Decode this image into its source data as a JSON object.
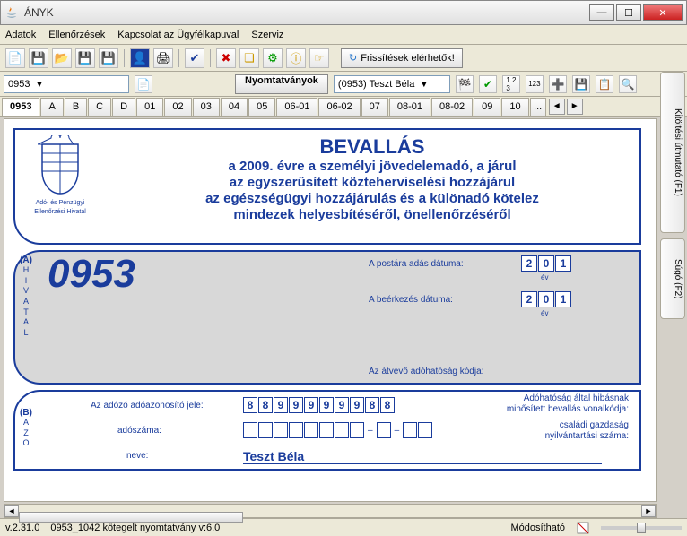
{
  "window": {
    "title": "ÁNYK"
  },
  "menu": {
    "items": [
      "Adatok",
      "Ellenőrzések",
      "Kapcsolat az Ügyfélkapuval",
      "Szerviz"
    ]
  },
  "toolbar": {
    "update_label": "Frissítések elérhetők!"
  },
  "selector": {
    "form_code": "0953",
    "nyom_label": "Nyomtatványok",
    "person": "(0953) Teszt Béla"
  },
  "tabs": [
    "0953",
    "A",
    "B",
    "C",
    "D",
    "01",
    "02",
    "03",
    "04",
    "05",
    "06-01",
    "06-02",
    "07",
    "08-01",
    "08-02",
    "09",
    "10"
  ],
  "form": {
    "apeh_line1": "Adó- és Pénzügyi",
    "apeh_line2": "Ellenőrzési Hivatal",
    "title": "BEVALLÁS",
    "sub1": "a 2009. évre a személyi jövedelemadó, a járul",
    "sub2": "az egyszerűsített közteherviselési hozzájárul",
    "sub3": "az egészségügyi hozzájárulás és a különadó kötelez",
    "sub4": "mindezek helyesbítéséről, önellenőrzéséről",
    "side_a": "(A)",
    "side_a_letters": [
      "H",
      "I",
      "V",
      "A",
      "T",
      "A",
      "L"
    ],
    "form_number": "0953",
    "post_date_label": "A postára adás dátuma:",
    "recv_date_label": "A beérkezés dátuma:",
    "ev": "év",
    "date1": [
      "2",
      "0",
      "1"
    ],
    "date2": [
      "2",
      "0",
      "1"
    ],
    "auth_code_label": "Az átvevő adóhatóság kódja:",
    "side_b": "(B)",
    "side_b_letters": [
      "A",
      "Z",
      "O"
    ],
    "tax_id_label": "Az adózó adóazonosító jele:",
    "tax_id": [
      "8",
      "8",
      "9",
      "9",
      "9",
      "9",
      "9",
      "9",
      "8",
      "8"
    ],
    "tax_num_label": "adószáma:",
    "name_label": "neve:",
    "name_value": "Teszt Béla",
    "hibas_label1": "Adóhatóság által hibásnak",
    "hibas_label2": "minősített bevallás vonalkódja:",
    "csaladi_label1": "családi gazdaság",
    "csaladi_label2": "nyilvántartási száma:"
  },
  "side": {
    "tab1": "Kitöltési útmutató (F1)",
    "tab2": "Súgó (F2)"
  },
  "status": {
    "version": "v.2.31.0",
    "doc": "0953_1042 kötegelt nyomtatvány v:6.0",
    "state": "Módosítható"
  }
}
